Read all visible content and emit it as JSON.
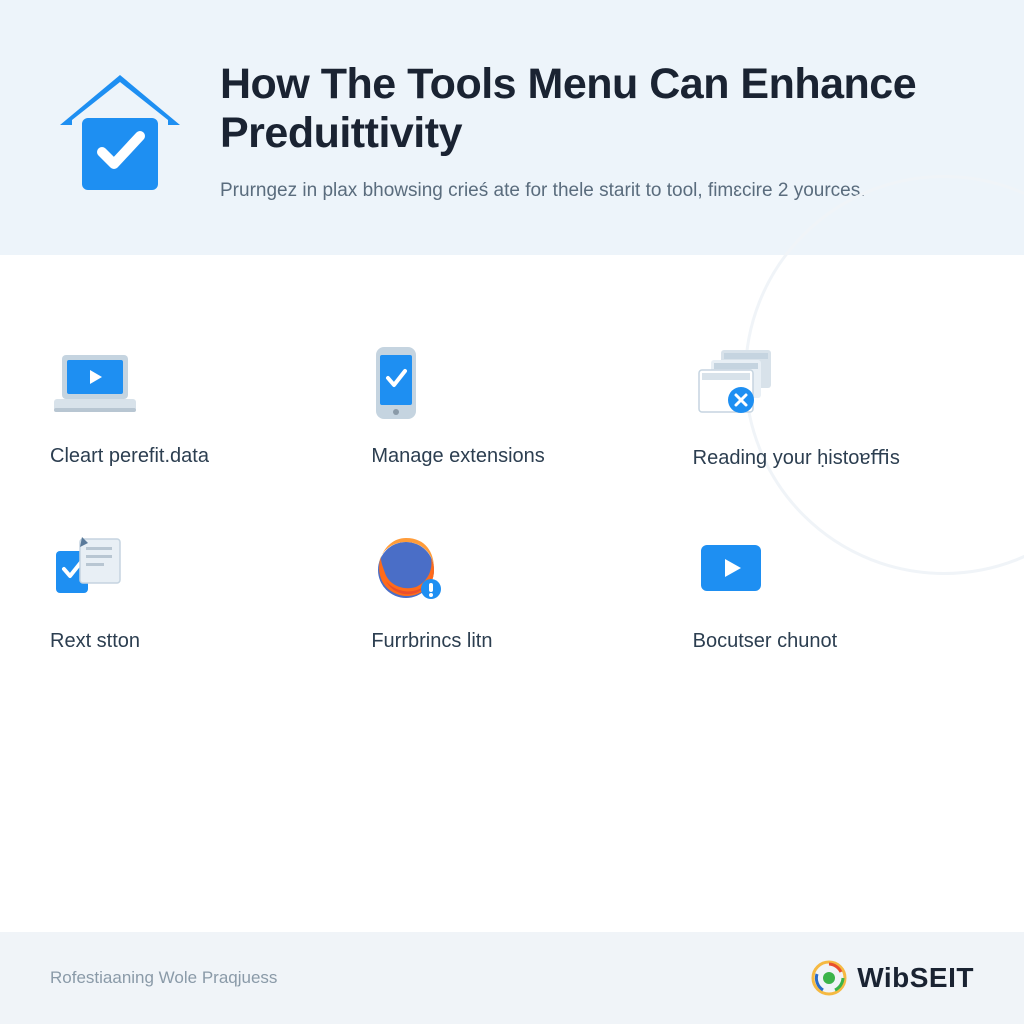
{
  "header": {
    "title": "How The Tools Menu Can Enhance Preduittivity",
    "subtitle": "Prurngez in plax bhowsing crieś ate for thele starit to tool, fimɛcire 2 yources."
  },
  "features": [
    {
      "label": "Cleart perefit.data",
      "icon": "laptop-play"
    },
    {
      "label": "Manage extensions",
      "icon": "phone-check"
    },
    {
      "label": "Reading your ḥistoɐﬃs",
      "icon": "windows-close"
    },
    {
      "label": "Rext stton",
      "icon": "check-doc"
    },
    {
      "label": "Furrbrincs litn",
      "icon": "firefox"
    },
    {
      "label": "Bocutser chunot",
      "icon": "play-card"
    }
  ],
  "footer": {
    "text": "Rofestiaaning Wole Praqjuess",
    "brand": "WibSEIT"
  },
  "colors": {
    "primary": "#1e8ff2",
    "dark": "#1a2332"
  }
}
